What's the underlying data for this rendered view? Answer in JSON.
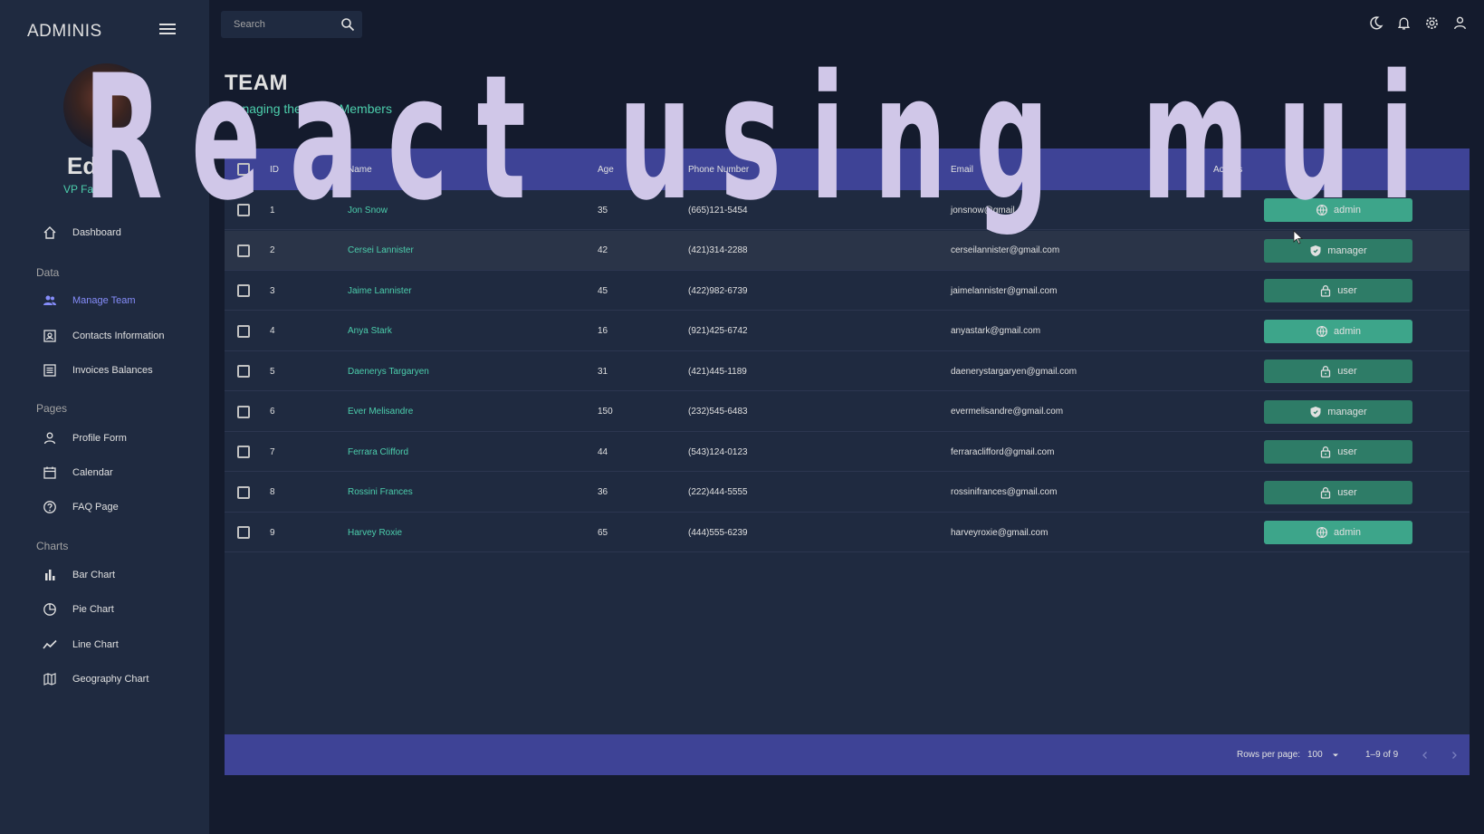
{
  "sidebar": {
    "brand": "ADMINIS",
    "profile": {
      "name": "Ed",
      "role": "VP Fa"
    },
    "sections": [
      "Data",
      "Pages",
      "Charts"
    ],
    "items": [
      {
        "label": "Dashboard",
        "icon": "home-icon"
      },
      {
        "label": "Manage Team",
        "icon": "people-icon",
        "active": true
      },
      {
        "label": "Contacts Information",
        "icon": "contacts-icon"
      },
      {
        "label": "Invoices Balances",
        "icon": "receipt-icon"
      },
      {
        "label": "Profile Form",
        "icon": "person-icon"
      },
      {
        "label": "Calendar",
        "icon": "calendar-icon"
      },
      {
        "label": "FAQ Page",
        "icon": "help-icon"
      },
      {
        "label": "Bar Chart",
        "icon": "bar-chart-icon"
      },
      {
        "label": "Pie Chart",
        "icon": "pie-chart-icon"
      },
      {
        "label": "Line Chart",
        "icon": "line-chart-icon"
      },
      {
        "label": "Geography Chart",
        "icon": "map-icon"
      }
    ]
  },
  "topbar": {
    "search_placeholder": "Search",
    "icons": [
      "dark-mode-icon",
      "notifications-icon",
      "settings-icon",
      "user-icon"
    ]
  },
  "header": {
    "title": "TEAM",
    "subtitle": "Managing the Team Members"
  },
  "grid": {
    "columns": {
      "id": "ID",
      "name": "Name",
      "age": "Age",
      "phone": "Phone Number",
      "email": "Email",
      "access": "Access"
    },
    "rows": [
      {
        "id": "1",
        "name": "Jon Snow",
        "age": "35",
        "phone": "(665)121-5454",
        "email": "jonsnow@gmail.com",
        "access": "admin"
      },
      {
        "id": "2",
        "name": "Cersei Lannister",
        "age": "42",
        "phone": "(421)314-2288",
        "email": "cerseilannister@gmail.com",
        "access": "manager"
      },
      {
        "id": "3",
        "name": "Jaime Lannister",
        "age": "45",
        "phone": "(422)982-6739",
        "email": "jaimelannister@gmail.com",
        "access": "user"
      },
      {
        "id": "4",
        "name": "Anya Stark",
        "age": "16",
        "phone": "(921)425-6742",
        "email": "anyastark@gmail.com",
        "access": "admin"
      },
      {
        "id": "5",
        "name": "Daenerys Targaryen",
        "age": "31",
        "phone": "(421)445-1189",
        "email": "daenerystargaryen@gmail.com",
        "access": "user"
      },
      {
        "id": "6",
        "name": "Ever Melisandre",
        "age": "150",
        "phone": "(232)545-6483",
        "email": "evermelisandre@gmail.com",
        "access": "manager"
      },
      {
        "id": "7",
        "name": "Ferrara Clifford",
        "age": "44",
        "phone": "(543)124-0123",
        "email": "ferraraclifford@gmail.com",
        "access": "user"
      },
      {
        "id": "8",
        "name": "Rossini Frances",
        "age": "36",
        "phone": "(222)444-5555",
        "email": "rossinifrances@gmail.com",
        "access": "user"
      },
      {
        "id": "9",
        "name": "Harvey Roxie",
        "age": "65",
        "phone": "(444)555-6239",
        "email": "harveyroxie@gmail.com",
        "access": "admin"
      }
    ],
    "footer": {
      "rows_per_page_label": "Rows per page:",
      "rows_per_page_value": "100",
      "range": "1–9 of 9"
    }
  },
  "overlay_text": "React using mui",
  "colors": {
    "background": "#141b2d",
    "panel": "#1f2a40",
    "header_band": "#3e4396",
    "accent_green": "#4cceac",
    "admin_badge": "#3da58a",
    "user_badge": "#2e7c67",
    "active_nav": "#868dfb",
    "overlay_text": "#d0c7e8"
  }
}
